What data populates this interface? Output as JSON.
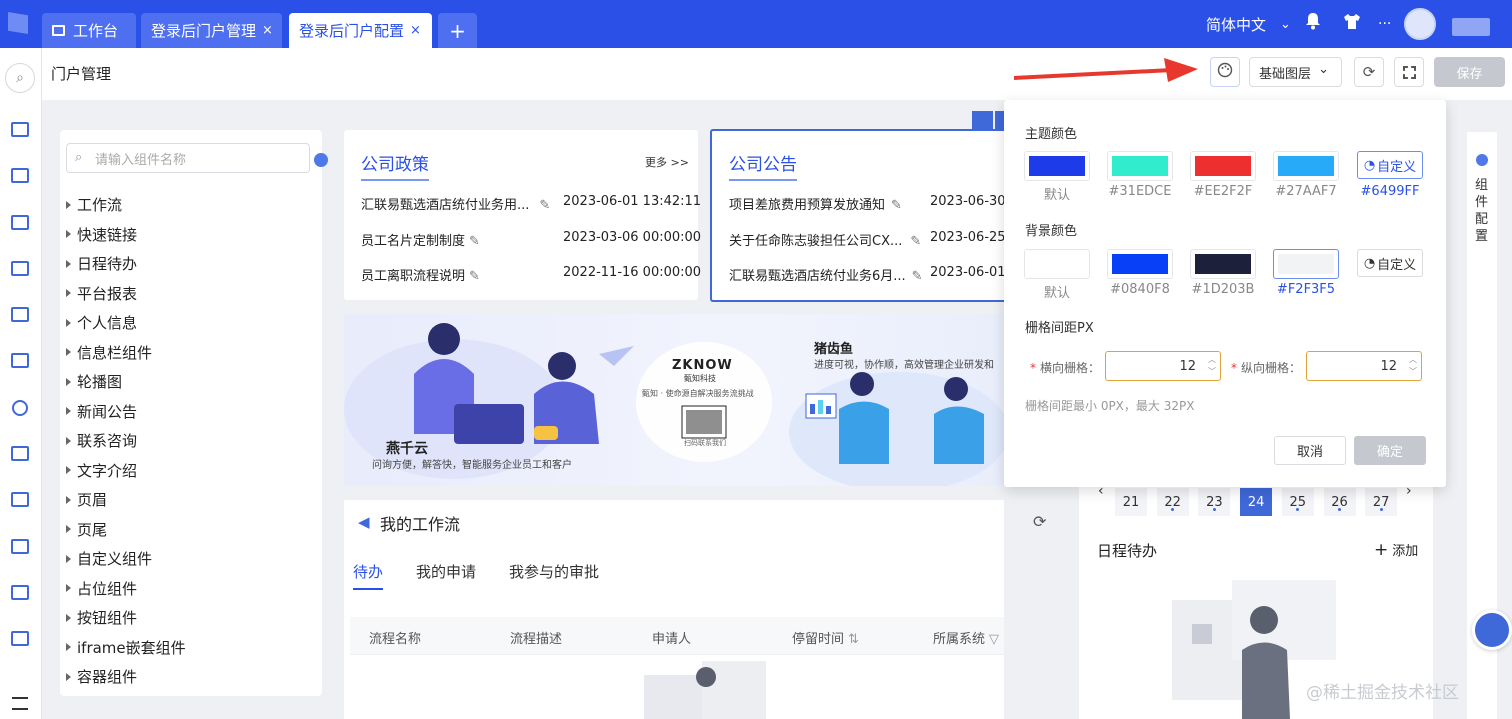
{
  "topbar": {
    "tabs": [
      {
        "label": "工作台"
      },
      {
        "label": "登录后门户管理",
        "close": "×"
      },
      {
        "label": "登录后门户配置",
        "close": "×"
      },
      {
        "label": "+"
      }
    ],
    "language": "简体中文",
    "language_caret": "⌄",
    "more": "···"
  },
  "page": {
    "title": "门户管理",
    "layer_select": "基础图层",
    "layer_caret": "⌄",
    "save": "保存"
  },
  "components": {
    "search_placeholder": "请输入组件名称",
    "items": [
      "工作流",
      "快速链接",
      "日程待办",
      "平台报表",
      "个人信息",
      "信息栏组件",
      "轮播图",
      "新闻公告",
      "联系咨询",
      "文字介绍",
      "页眉",
      "页尾",
      "自定义组件",
      "占位组件",
      "按钮组件",
      "iframe嵌套组件",
      "容器组件"
    ]
  },
  "policy": {
    "title": "公司政策",
    "more": "更多 >>",
    "rows": [
      {
        "text": "汇联易甄选酒店统付业务用...",
        "date": "2023-06-01 13:42:11"
      },
      {
        "text": "员工名片定制制度",
        "date": "2023-03-06 00:00:00"
      },
      {
        "text": "员工离职流程说明",
        "date": "2022-11-16 00:00:00"
      }
    ]
  },
  "notice": {
    "title": "公司公告",
    "rows": [
      {
        "text": "项目差旅费用预算发放通知",
        "date": "2023-06-30 1"
      },
      {
        "text": "关于任命陈志骏担任公司CX...",
        "date": "2023-06-25 1"
      },
      {
        "text": "汇联易甄选酒店统付业务6月...",
        "date": "2023-06-01 1"
      }
    ]
  },
  "banner": {
    "left_title": "燕千云",
    "left_sub": "问询方便，解答快，智能服务企业员工和客户",
    "center_logo": "ZKNOW",
    "center_logo_sub": "甄知科技",
    "center_slogan": "甄知 · 使命源自解决服务流挑战",
    "center_qr_caption": "扫码联系我们",
    "right_title": "猪齿鱼",
    "right_sub": "进度可视，协作顺，高效管理企业研发和"
  },
  "workflow": {
    "title": "我的工作流",
    "tabs": [
      "待办",
      "我的申请",
      "我参与的审批"
    ],
    "columns": [
      "流程名称",
      "流程描述",
      "申请人",
      "停留时间",
      "所属系统"
    ]
  },
  "calendar": {
    "days": [
      "21",
      "22",
      "23",
      "24",
      "25",
      "26",
      "27"
    ],
    "selected_day": "24",
    "schedule_title": "日程待办",
    "add_label": "添加"
  },
  "popup": {
    "theme_label": "主题颜色",
    "theme_colors": [
      {
        "hex": "#1D3BE8",
        "label": "默认"
      },
      {
        "hex": "#31EDCE",
        "label": "#31EDCE"
      },
      {
        "hex": "#EE2F2F",
        "label": "#EE2F2F"
      },
      {
        "hex": "#27AAF7",
        "label": "#27AAF7"
      }
    ],
    "theme_custom": "自定义",
    "theme_custom_value": "#6499FF",
    "bg_label": "背景颜色",
    "bg_colors": [
      {
        "hex": "#FFFFFF",
        "label": "默认"
      },
      {
        "hex": "#0840F8",
        "label": "#0840F8"
      },
      {
        "hex": "#1D203B",
        "label": "#1D203B"
      },
      {
        "hex": "#F2F3F5",
        "label": "#F2F3F5"
      }
    ],
    "bg_custom": "自定义",
    "grid_label": "栅格间距PX",
    "h_grid_label": "横向栅格：",
    "h_grid_value": "12",
    "v_grid_label": "纵向栅格：",
    "v_grid_value": "12",
    "hint": "栅格间距最小 0PX，最大 32PX",
    "cancel": "取消",
    "ok": "确定"
  },
  "side_config": {
    "label": "组件配置"
  },
  "watermark": "@稀土掘金技术社区",
  "colors": {
    "brand": "#2A50E8",
    "arrow": "#E8372C",
    "accent": "#3F68D8"
  }
}
